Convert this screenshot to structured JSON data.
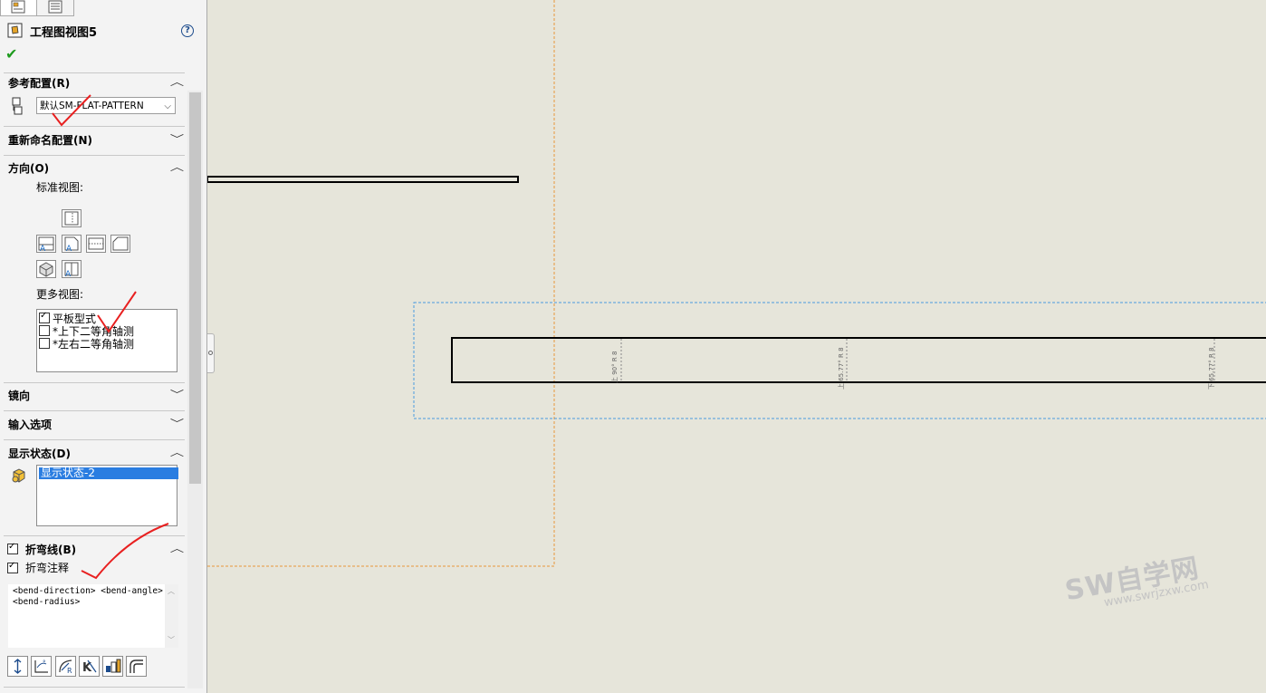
{
  "panel": {
    "title": "工程图视图5",
    "help": "?",
    "sections": {
      "reference_config": {
        "title": "参考配置(R)",
        "selected": "默认SM-FLAT-PATTERN"
      },
      "rename_config": {
        "title": "重新命名配置(N)"
      },
      "orientation": {
        "title": "方向(O)",
        "standard_views_label": "标准视图:",
        "more_views_label": "更多视图:",
        "more_views": [
          {
            "label": "平板型式",
            "checked": true
          },
          {
            "label": "*上下二等角轴测",
            "checked": false
          },
          {
            "label": "*左右二等角轴测",
            "checked": false
          }
        ]
      },
      "mirror": {
        "title": "镜向"
      },
      "import_options": {
        "title": "输入选项"
      },
      "display_state": {
        "title": "显示状态(D)",
        "selected": "显示状态-2"
      },
      "bend_lines": {
        "title": "折弯线(B)",
        "checked": true
      },
      "bend_notes": {
        "title": "折弯注释",
        "checked": true,
        "note_text": "<bend-direction> <bend-angle> R <bend-radius>"
      }
    }
  },
  "drawing": {
    "bend_labels": [
      "上 90° R 8",
      "上 65.77° R 8",
      "下 65.77° R 8"
    ]
  },
  "watermark": {
    "main": "SW自学网",
    "url": "www.swrjzxw.com"
  },
  "colors": {
    "accent": "#2a7de1",
    "sheet_border": "#e8963a",
    "view_boundary": "#4a9ce0",
    "annotation": "#e82020"
  }
}
